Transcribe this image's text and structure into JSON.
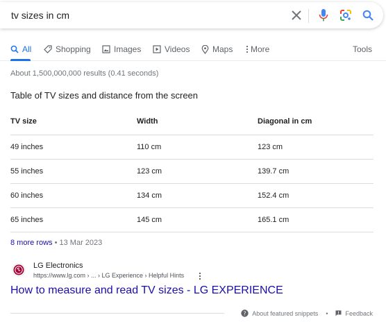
{
  "search": {
    "query": "tv sizes in cm"
  },
  "tabs": [
    {
      "label": "All",
      "icon": "search-icon",
      "active": true
    },
    {
      "label": "Shopping",
      "icon": "tag-icon"
    },
    {
      "label": "Images",
      "icon": "image-icon"
    },
    {
      "label": "Videos",
      "icon": "play-icon"
    },
    {
      "label": "Maps",
      "icon": "map-pin-icon"
    },
    {
      "label": "More",
      "icon": "more-vert-icon"
    }
  ],
  "tools_label": "Tools",
  "result_stats": "About 1,500,000,000 results (0.41 seconds)",
  "snippet": {
    "title": "Table of TV sizes and distance from the screen",
    "headers": [
      "TV size",
      "Width",
      "Diagonal in cm"
    ],
    "rows": [
      [
        "49 inches",
        "110 cm",
        "123 cm"
      ],
      [
        "55 inches",
        "123 cm",
        "139.7 cm"
      ],
      [
        "60 inches",
        "134 cm",
        "152.4 cm"
      ],
      [
        "65 inches",
        "145 cm",
        "165.1 cm"
      ]
    ],
    "more_rows": "8 more rows",
    "separator": "•",
    "date": "13 Mar 2023"
  },
  "source": {
    "name": "LG Electronics",
    "url": "https://www.lg.com › ... › LG Experience › Helpful Hints",
    "result_title": "How to measure and read TV sizes - LG EXPERIENCE"
  },
  "footer": {
    "about_label": "About featured snippets",
    "separator": "•",
    "feedback_label": "Feedback"
  },
  "colors": {
    "link": "#1a0dab",
    "accent": "#1a73e8",
    "lg_brand": "#a50034"
  }
}
